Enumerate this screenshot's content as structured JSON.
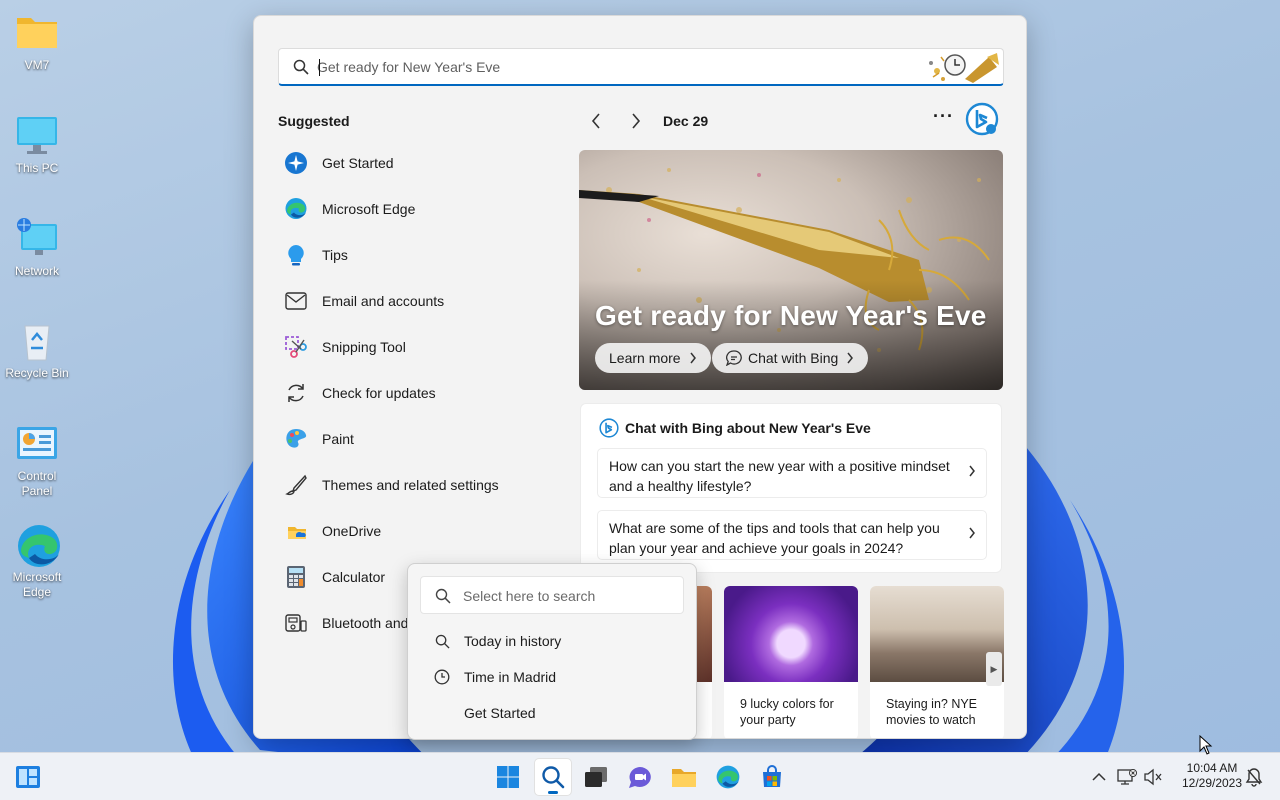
{
  "desktop": {
    "icons": [
      {
        "label": "VM7",
        "icon": "folder-icon"
      },
      {
        "label": "This PC",
        "icon": "monitor-icon"
      },
      {
        "label": "Network",
        "icon": "network-icon"
      },
      {
        "label": "Recycle Bin",
        "icon": "recycle-bin-icon"
      },
      {
        "label": "Control Panel",
        "icon": "control-panel-icon"
      },
      {
        "label": "Microsoft Edge",
        "icon": "edge-icon"
      }
    ]
  },
  "search": {
    "placeholder": "Get ready for New Year's Eve"
  },
  "suggested": {
    "title": "Suggested",
    "items": [
      {
        "label": "Get Started",
        "icon": "get-started-icon"
      },
      {
        "label": "Microsoft Edge",
        "icon": "edge-icon"
      },
      {
        "label": "Tips",
        "icon": "tips-icon"
      },
      {
        "label": "Email and accounts",
        "icon": "mail-icon"
      },
      {
        "label": "Snipping Tool",
        "icon": "snipping-tool-icon"
      },
      {
        "label": "Check for updates",
        "icon": "refresh-icon"
      },
      {
        "label": "Paint",
        "icon": "paint-icon"
      },
      {
        "label": "Themes and related settings",
        "icon": "brush-icon"
      },
      {
        "label": "OneDrive",
        "icon": "onedrive-icon"
      },
      {
        "label": "Calculator",
        "icon": "calculator-icon"
      },
      {
        "label": "Bluetooth and",
        "icon": "bluetooth-devices-icon"
      }
    ]
  },
  "highlights": {
    "date": "Dec 29",
    "more": "···",
    "hero": {
      "title": "Get ready for New Year's Eve",
      "learn_more": "Learn more",
      "chat_with_bing": "Chat with Bing"
    },
    "chat": {
      "title": "Chat with Bing about New Year's Eve",
      "questions": [
        "How can you start the new year with a positive mindset and a healthy lifestyle?",
        "What are some of the tips and tools that can help you plan your year and achieve your goals in 2024?"
      ]
    },
    "tiles": [
      {
        "caption": "9 lucky colors for your party"
      },
      {
        "caption": "Staying in? NYE movies to watch"
      }
    ]
  },
  "popup": {
    "placeholder": "Select here to search",
    "items": [
      {
        "label": "Today in history",
        "icon": "search-icon"
      },
      {
        "label": "Time in Madrid",
        "icon": "clock-icon"
      },
      {
        "label": "Get Started",
        "icon": ""
      }
    ]
  },
  "taskbar": {
    "time": "10:04 AM",
    "date": "12/29/2023"
  },
  "colors": {
    "accent": "#0067c0",
    "bing": "#1e88d4"
  }
}
